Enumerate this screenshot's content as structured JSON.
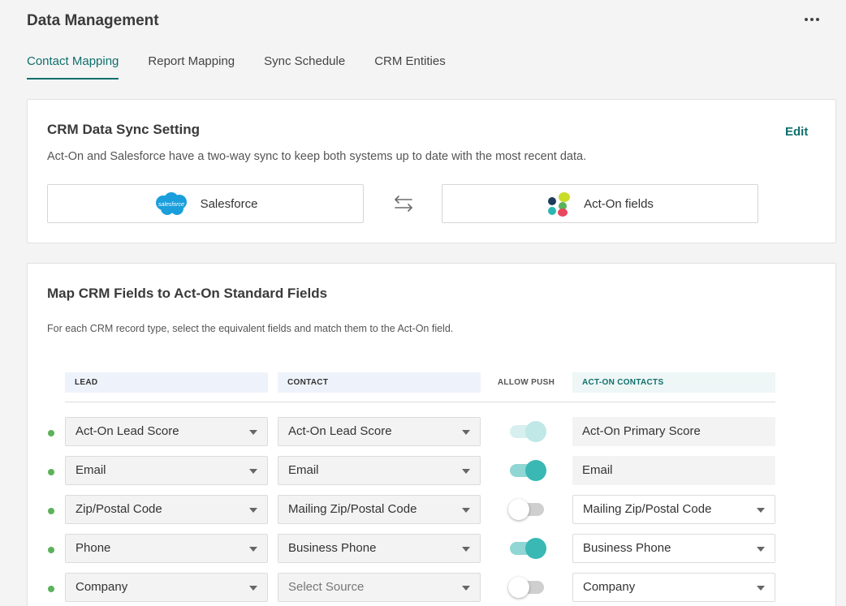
{
  "header": {
    "title": "Data Management",
    "more_icon": "more-horizontal-icon"
  },
  "tabs": [
    {
      "label": "Contact Mapping",
      "active": true
    },
    {
      "label": "Report Mapping",
      "active": false
    },
    {
      "label": "Sync Schedule",
      "active": false
    },
    {
      "label": "CRM Entities",
      "active": false
    }
  ],
  "sync_card": {
    "title": "CRM Data Sync Setting",
    "edit_label": "Edit",
    "description": "Act-On and Salesforce have a two-way sync to keep both systems up to date with the most recent data.",
    "left_system": {
      "label": "Salesforce",
      "logo_text": "salesforce",
      "icon": "salesforce-logo-icon"
    },
    "arrow_icon": "two-way-sync-arrows-icon",
    "right_system": {
      "label": "Act-On fields",
      "icon": "act-on-logo-icon"
    }
  },
  "map_card": {
    "title": "Map CRM Fields to Act-On Standard Fields",
    "description": "For each CRM record type, select the equivalent fields and match them to the Act-On field.",
    "columns": {
      "lead": "LEAD",
      "contact": "CONTACT",
      "allow_push": "ALLOW PUSH",
      "acton": "ACT-ON CONTACTS"
    },
    "rows": [
      {
        "lead": "Act-On Lead Score",
        "contact": "Act-On Lead Score",
        "allow_push": "on-disabled",
        "acton": "Act-On Primary Score",
        "acton_editable": false
      },
      {
        "lead": "Email",
        "contact": "Email",
        "allow_push": "on",
        "acton": "Email",
        "acton_editable": false
      },
      {
        "lead": "Zip/Postal Code",
        "contact": "Mailing Zip/Postal Code",
        "allow_push": "off",
        "acton": "Mailing Zip/Postal Code",
        "acton_editable": true
      },
      {
        "lead": "Phone",
        "contact": "Business Phone",
        "allow_push": "on",
        "acton": "Business Phone",
        "acton_editable": true
      },
      {
        "lead": "Company",
        "contact": "Select Source",
        "contact_placeholder": true,
        "allow_push": "off",
        "acton": "Company",
        "acton_editable": true
      }
    ]
  },
  "colors": {
    "accent": "#0f6f6c",
    "toggle_on": "#3ab8b4",
    "status_dot": "#5bb25a"
  }
}
